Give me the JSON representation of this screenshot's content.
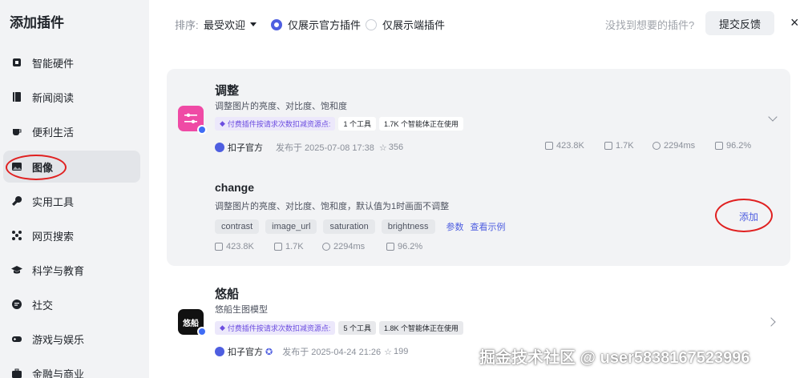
{
  "sidebar": {
    "title": "添加插件",
    "items": [
      {
        "label": "智能硬件",
        "icon": "chip-icon"
      },
      {
        "label": "新闻阅读",
        "icon": "book-icon"
      },
      {
        "label": "便利生活",
        "icon": "cup-icon"
      },
      {
        "label": "图像",
        "icon": "image-icon",
        "active": true
      },
      {
        "label": "实用工具",
        "icon": "wrench-icon"
      },
      {
        "label": "网页搜索",
        "icon": "network-icon"
      },
      {
        "label": "科学与教育",
        "icon": "graduation-cap-icon"
      },
      {
        "label": "社交",
        "icon": "chat-icon"
      },
      {
        "label": "游戏与娱乐",
        "icon": "gamepad-icon"
      },
      {
        "label": "金融与商业",
        "icon": "briefcase-icon"
      }
    ]
  },
  "toolbar": {
    "sort_label": "排序:",
    "sort_value": "最受欢迎",
    "filter_official": "仅展示官方插件",
    "filter_device": "仅展示端插件",
    "hint": "没找到想要的插件?",
    "feedback": "提交反馈",
    "close": "×"
  },
  "plugins": [
    {
      "title": "调整",
      "desc": "调整图片的亮度、对比度、饱和度",
      "paid_tag": "付费插件按请求次数扣减资源点:",
      "tools_count": "1 个工具",
      "agents_using": "1.7K 个智能体正在使用",
      "author": "扣子官方",
      "published": "发布于 2025-07-08 17:38",
      "stars": "356",
      "calls": "423.8K",
      "bots": "1.7K",
      "latency": "2294ms",
      "success": "96.2%",
      "tool": {
        "name": "change",
        "desc": "调整图片的亮度、对比度、饱和度，默认值为1时画面不调整",
        "params": [
          "contrast",
          "image_url",
          "saturation",
          "brightness"
        ],
        "params_link": "参数",
        "example_link": "查看示例",
        "add": "添加",
        "calls": "423.8K",
        "bots": "1.7K",
        "latency": "2294ms",
        "success": "96.2%"
      }
    },
    {
      "title": "悠船",
      "desc": "悠船生图模型",
      "icon_text": "悠船",
      "paid_tag": "付费插件按请求次数扣减资源点:",
      "tools_count": "5 个工具",
      "agents_using": "1.8K 个智能体正在使用",
      "author": "扣子官方",
      "published": "发布于 2025-04-24 21:26",
      "stars": "199"
    }
  ],
  "watermark": "掘金技术社区 @ user5838167523996",
  "colors": {
    "accent": "#4e5ee0",
    "annotation": "#e02020",
    "adjust_icon": "#ef4aa5"
  }
}
